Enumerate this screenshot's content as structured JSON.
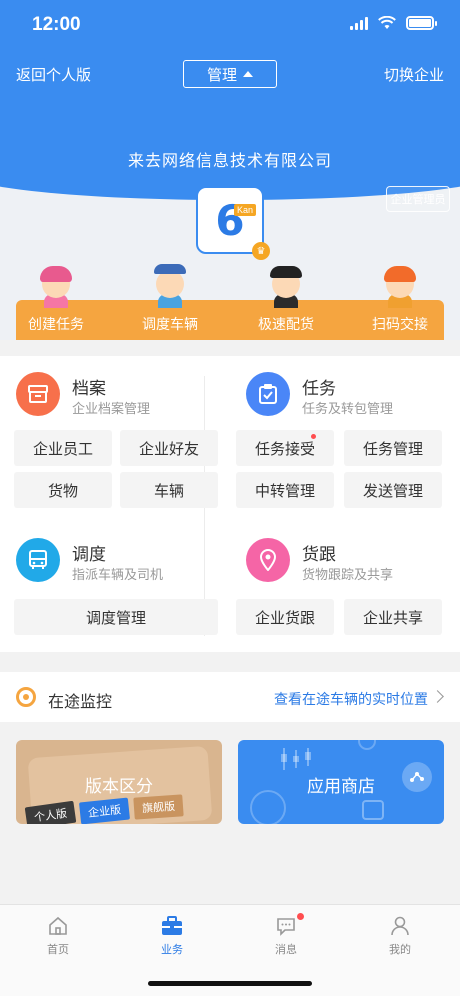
{
  "status_bar": {
    "time": "12:00"
  },
  "nav": {
    "back_label": "返回个人版",
    "mode_label": "管理",
    "switch_label": "切换企业"
  },
  "company": {
    "name": "来去网络信息技术有限公司",
    "admin_badge": "企业管理员",
    "logo_number": "6",
    "logo_text": "Kan"
  },
  "quick_actions": [
    {
      "label": "创建任务"
    },
    {
      "label": "调度车辆"
    },
    {
      "label": "极速配货"
    },
    {
      "label": "扫码交接"
    }
  ],
  "sections": {
    "archive": {
      "title": "档案",
      "subtitle": "企业档案管理",
      "items": [
        "企业员工",
        "企业好友",
        "货物",
        "车辆"
      ]
    },
    "task": {
      "title": "任务",
      "subtitle": "任务及转包管理",
      "items": [
        "任务接受",
        "任务管理",
        "中转管理",
        "发送管理"
      ]
    },
    "dispatch": {
      "title": "调度",
      "subtitle": "指派车辆及司机",
      "items": [
        "调度管理"
      ]
    },
    "tracking": {
      "title": "货跟",
      "subtitle": "货物跟踪及共享",
      "items": [
        "企业货跟",
        "企业共享"
      ]
    }
  },
  "monitor": {
    "title": "在途监控",
    "link": "查看在途车辆的实时位置"
  },
  "banners": {
    "edition": {
      "title": "版本区分",
      "tags": [
        "个人版",
        "企业版",
        "旗舰版"
      ]
    },
    "store": {
      "title": "应用商店"
    }
  },
  "tabs": [
    {
      "label": "首页",
      "icon": "home-icon"
    },
    {
      "label": "业务",
      "icon": "briefcase-icon",
      "active": true
    },
    {
      "label": "消息",
      "icon": "message-icon",
      "badge": true
    },
    {
      "label": "我的",
      "icon": "user-icon"
    }
  ],
  "colors": {
    "primary": "#3a8cf0",
    "accent_orange": "#f5a540",
    "archive_icon": "#f7704b",
    "task_icon": "#4a86f7",
    "dispatch_icon": "#21a9e8",
    "tracking_icon": "#f565a6"
  }
}
